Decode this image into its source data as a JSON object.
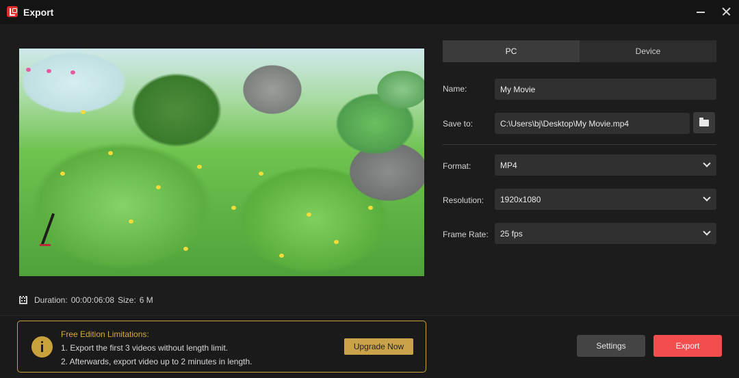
{
  "window": {
    "title": "Export"
  },
  "preview": {
    "duration_label": "Duration:",
    "duration_value": "00:00:06:08",
    "size_label": "Size:",
    "size_value": "6 M"
  },
  "tabs": [
    {
      "label": "PC",
      "active": true
    },
    {
      "label": "Device",
      "active": false
    }
  ],
  "form": {
    "name_label": "Name:",
    "name_value": "My Movie",
    "save_label": "Save to:",
    "save_value": "C:\\Users\\bj\\Desktop\\My Movie.mp4",
    "format_label": "Format:",
    "format_value": "MP4",
    "resolution_label": "Resolution:",
    "resolution_value": "1920x1080",
    "framerate_label": "Frame Rate:",
    "framerate_value": "25 fps"
  },
  "notice": {
    "title": "Free Edition Limitations:",
    "line1": "1. Export the first 3 videos without length limit.",
    "line2": "2. Afterwards, export video up to 2 minutes in length.",
    "upgrade_label": "Upgrade Now"
  },
  "actions": {
    "settings_label": "Settings",
    "export_label": "Export"
  },
  "colors": {
    "accent_export": "#f34d4d",
    "notice_gold": "#c9a23c"
  }
}
